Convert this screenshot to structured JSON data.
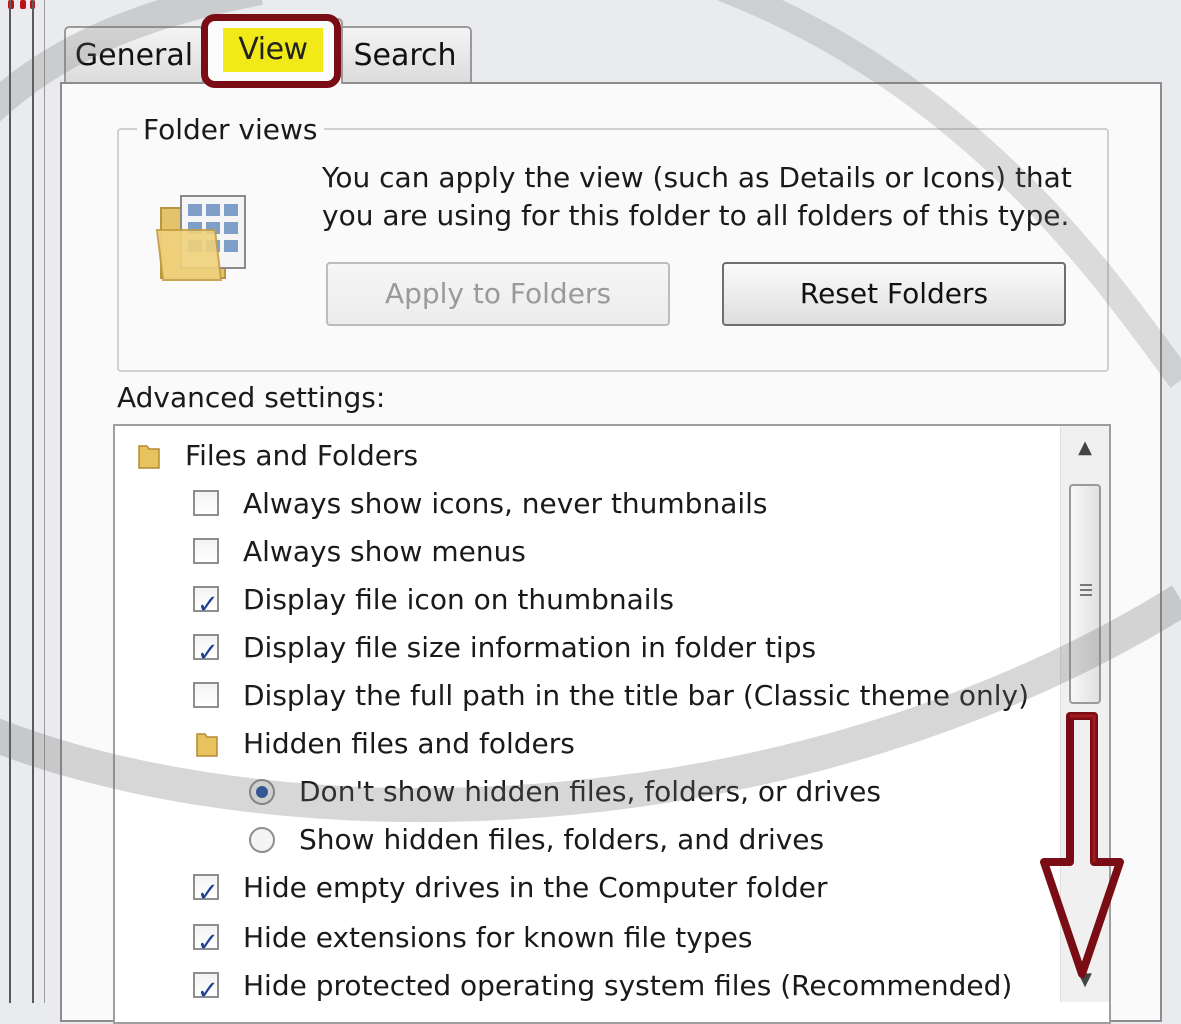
{
  "tabs": {
    "general": "General",
    "view": "View",
    "search": "Search"
  },
  "folder_views": {
    "title": "Folder views",
    "description_line1": "You can apply the view (such as Details or Icons) that",
    "description_line2": "you are using for this folder to all folders of this type.",
    "apply_button": "Apply to Folders",
    "reset_button": "Reset Folders"
  },
  "advanced": {
    "label": "Advanced settings:",
    "items": [
      {
        "type": "folder",
        "label": "Files and Folders"
      },
      {
        "type": "checkbox",
        "checked": false,
        "label": "Always show icons, never thumbnails"
      },
      {
        "type": "checkbox",
        "checked": false,
        "label": "Always show menus"
      },
      {
        "type": "checkbox",
        "checked": true,
        "label": "Display file icon on thumbnails"
      },
      {
        "type": "checkbox",
        "checked": true,
        "label": "Display file size information in folder tips"
      },
      {
        "type": "checkbox",
        "checked": false,
        "label": "Display the full path in the title bar (Classic theme only)"
      },
      {
        "type": "folder",
        "label": "Hidden files and folders"
      },
      {
        "type": "radio",
        "checked": true,
        "label": "Don't show hidden files, folders, or drives"
      },
      {
        "type": "radio",
        "checked": false,
        "label": "Show hidden files, folders, and drives"
      },
      {
        "type": "checkbox",
        "checked": true,
        "label": "Hide empty drives in the Computer folder"
      },
      {
        "type": "checkbox",
        "checked": true,
        "label": "Hide extensions for known file types"
      },
      {
        "type": "checkbox",
        "checked": true,
        "label": "Hide protected operating system files (Recommended)"
      }
    ]
  },
  "colors": {
    "highlight_border": "#7a0d13",
    "highlight_fill": "#f2ea18",
    "annotation_arrow": "#7a0d13",
    "checkmark": "#1f3f8f"
  }
}
